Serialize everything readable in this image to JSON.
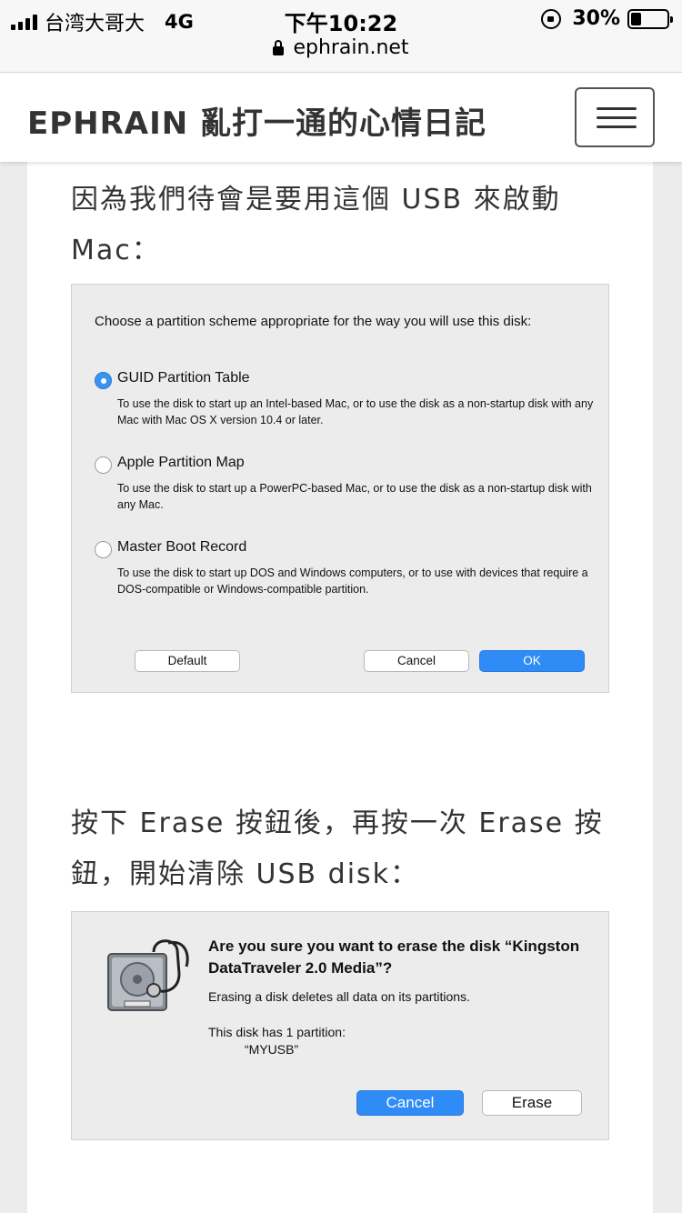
{
  "status_bar": {
    "carrier": "台湾大哥大",
    "network": "4G",
    "time": "下午10:22",
    "battery": "30%",
    "battery_level": 0.3,
    "url": "ephrain.net"
  },
  "header": {
    "site_title": "EPHRAIN 亂打一通的心情日記",
    "menu_icon": "hamburger-icon"
  },
  "article": {
    "para1": "因為我們待會是要用這個 USB 來啟動 Mac：",
    "para2": "按下 Erase 按鈕後，再按一次 Erase 按鈕，開始清除 USB disk："
  },
  "partition_dialog": {
    "prompt": "Choose a partition scheme appropriate for the way you will use this disk:",
    "options": [
      {
        "title": "GUID Partition Table",
        "desc": "To use the disk to start up an Intel-based Mac, or to use the disk as a non-startup disk with any Mac with Mac OS X version 10.4 or later.",
        "selected": true
      },
      {
        "title": "Apple Partition Map",
        "desc": "To use the disk to start up a PowerPC-based Mac, or to use the disk as a non-startup disk with any Mac.",
        "selected": false
      },
      {
        "title": "Master Boot Record",
        "desc": "To use the disk to start up DOS and Windows computers, or to use with devices that require a DOS-compatible or Windows-compatible partition.",
        "selected": false
      }
    ],
    "default_label": "Default",
    "cancel_label": "Cancel",
    "ok_label": "OK"
  },
  "erase_dialog": {
    "title": "Are you sure you want to erase the disk “Kingston DataTraveler 2.0 Media”?",
    "info": "Erasing a disk deletes all data on its partitions.",
    "partition_line": "This disk has 1 partition:",
    "partition_name": "“MYUSB”",
    "cancel_label": "Cancel",
    "erase_label": "Erase",
    "icon": "disk-utility-icon"
  }
}
